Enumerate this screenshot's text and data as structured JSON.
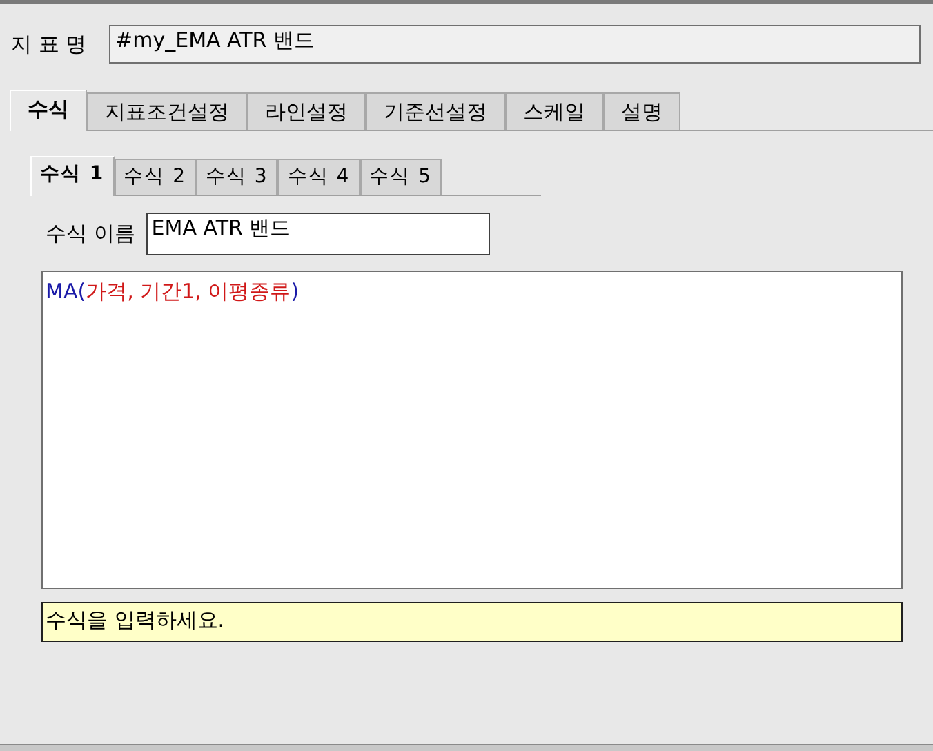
{
  "indicator_name": {
    "label": "지 표 명",
    "value": "#my_EMA ATR 밴드"
  },
  "tabs": [
    {
      "label": "수식",
      "selected": true
    },
    {
      "label": "지표조건설정",
      "selected": false
    },
    {
      "label": "라인설정",
      "selected": false
    },
    {
      "label": "기준선설정",
      "selected": false
    },
    {
      "label": "스케일",
      "selected": false
    },
    {
      "label": "설명",
      "selected": false
    }
  ],
  "formula_tabs": [
    {
      "label": "수식 1",
      "selected": true
    },
    {
      "label": "수식 2",
      "selected": false
    },
    {
      "label": "수식 3",
      "selected": false
    },
    {
      "label": "수식 4",
      "selected": false
    },
    {
      "label": "수식 5",
      "selected": false
    }
  ],
  "formula_name": {
    "label": "수식 이름",
    "value": "EMA ATR 밴드"
  },
  "formula_editor": {
    "tokens": [
      {
        "kind": "function",
        "text": "MA("
      },
      {
        "kind": "argument",
        "text": "가격, 기간1, 이평종류"
      },
      {
        "kind": "function",
        "text": ")"
      }
    ]
  },
  "hint": "수식을 입력하세요."
}
